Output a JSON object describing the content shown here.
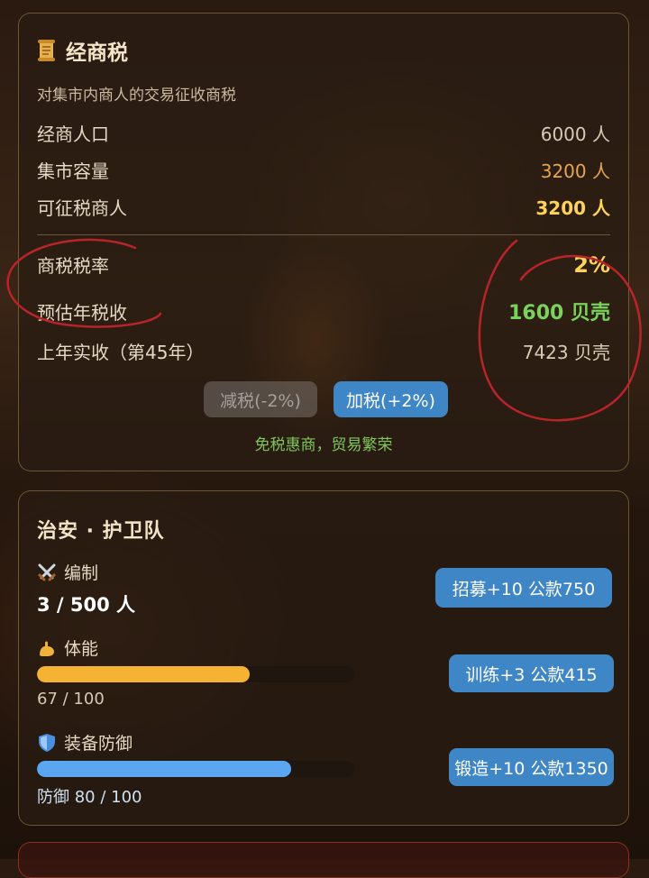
{
  "tax_card": {
    "title": "经商税",
    "subtitle": "对集市内商人的交易征收商税",
    "rows": [
      {
        "label": "经商人口",
        "value": "6000 人"
      },
      {
        "label": "集市容量",
        "value": "3200 人"
      },
      {
        "label": "可征税商人",
        "value": "3200 人"
      },
      {
        "label": "商税税率",
        "value": "2%"
      },
      {
        "label": "预估年税收",
        "value": "1600 贝壳"
      },
      {
        "label": "上年实收（第45年）",
        "value": "7423 贝壳"
      }
    ],
    "decrease_label": "减税(-2%)",
    "increase_label": "加税(+2%)",
    "hint": "免税惠商，贸易繁荣"
  },
  "guard_card": {
    "title": "治安 · 护卫队",
    "roster": {
      "label": "编制",
      "value": "3 / 500 人",
      "action": "招募+10 公款750"
    },
    "stamina": {
      "label": "体能",
      "value": "67 / 100",
      "progress": 0.67,
      "action": "训练+3 公款415"
    },
    "armor": {
      "label": "装备防御",
      "value": "防御 80 / 100",
      "progress": 0.8,
      "action": "锻造+10 公款1350"
    }
  },
  "colors": {
    "accent_blue": "#3f86c6",
    "stamina_bar": "#f6b233",
    "armor_bar": "#5aa6f0",
    "positive_green": "#7ad35a",
    "highlight_yellow": "#ffd35a",
    "annotation_red": "#b8242a"
  },
  "icons": {
    "title": "scroll-icon",
    "roster": "crossed-swords-icon",
    "stamina": "flexed-arm-icon",
    "armor": "shield-icon"
  }
}
